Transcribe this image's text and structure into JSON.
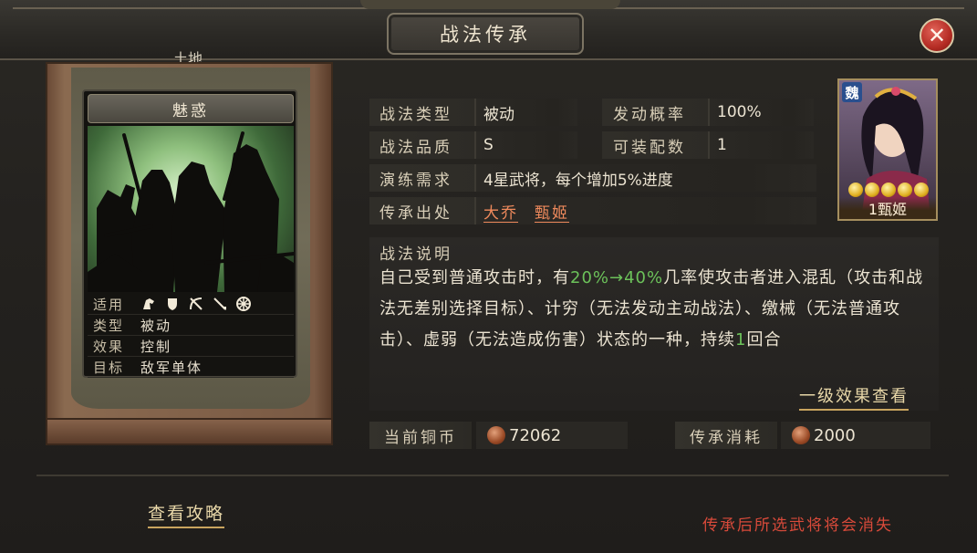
{
  "window": {
    "title": "战法传承",
    "corner_label": "土地",
    "close_label": "✕"
  },
  "skill_card": {
    "name": "魅惑",
    "stats": [
      {
        "key": "适用",
        "value": ""
      },
      {
        "key": "类型",
        "value": "被动"
      },
      {
        "key": "效果",
        "value": "控制"
      },
      {
        "key": "目标",
        "value": "敌军单体"
      }
    ],
    "unit_icons": [
      "cavalry-icon",
      "shield-icon",
      "archer-icon",
      "spear-icon",
      "chariot-icon"
    ]
  },
  "info": {
    "type_label": "战法类型",
    "type_value": "被动",
    "rate_label": "发动概率",
    "rate_value": "100%",
    "quality_label": "战法品质",
    "quality_value": "S",
    "equip_label": "可装配数",
    "equip_value": "1",
    "train_label": "演练需求",
    "train_value": "4星武将，每个增加5%进度",
    "source_label": "传承出处",
    "source_values": [
      "大乔",
      "甄姬"
    ]
  },
  "portrait": {
    "faction": "魏",
    "stars": 5,
    "name": "1甄姬"
  },
  "description": {
    "title": "战法说明",
    "part1": "自己受到普通攻击时，有",
    "highlight": "20%→40%",
    "part2": "几率使攻击者进入混乱（攻击和战法无差别选择目标）、计穷（无法发动主动战法）、缴械（无法普通攻击）、虚弱（无法造成伤害）状态的一种，持续",
    "highlight2": "1",
    "part3": "回合",
    "detail_link": "一级效果查看"
  },
  "cost": {
    "coins_label": "当前铜币",
    "coins_value": "72062",
    "consume_label": "传承消耗",
    "consume_value": "2000"
  },
  "footer": {
    "guide_link": "查看攻略",
    "warning": "传承后所选武将将会消失"
  },
  "colors": {
    "highlight": "#6cc25a",
    "link": "#ef8a5c",
    "warning": "#d84a3a"
  }
}
